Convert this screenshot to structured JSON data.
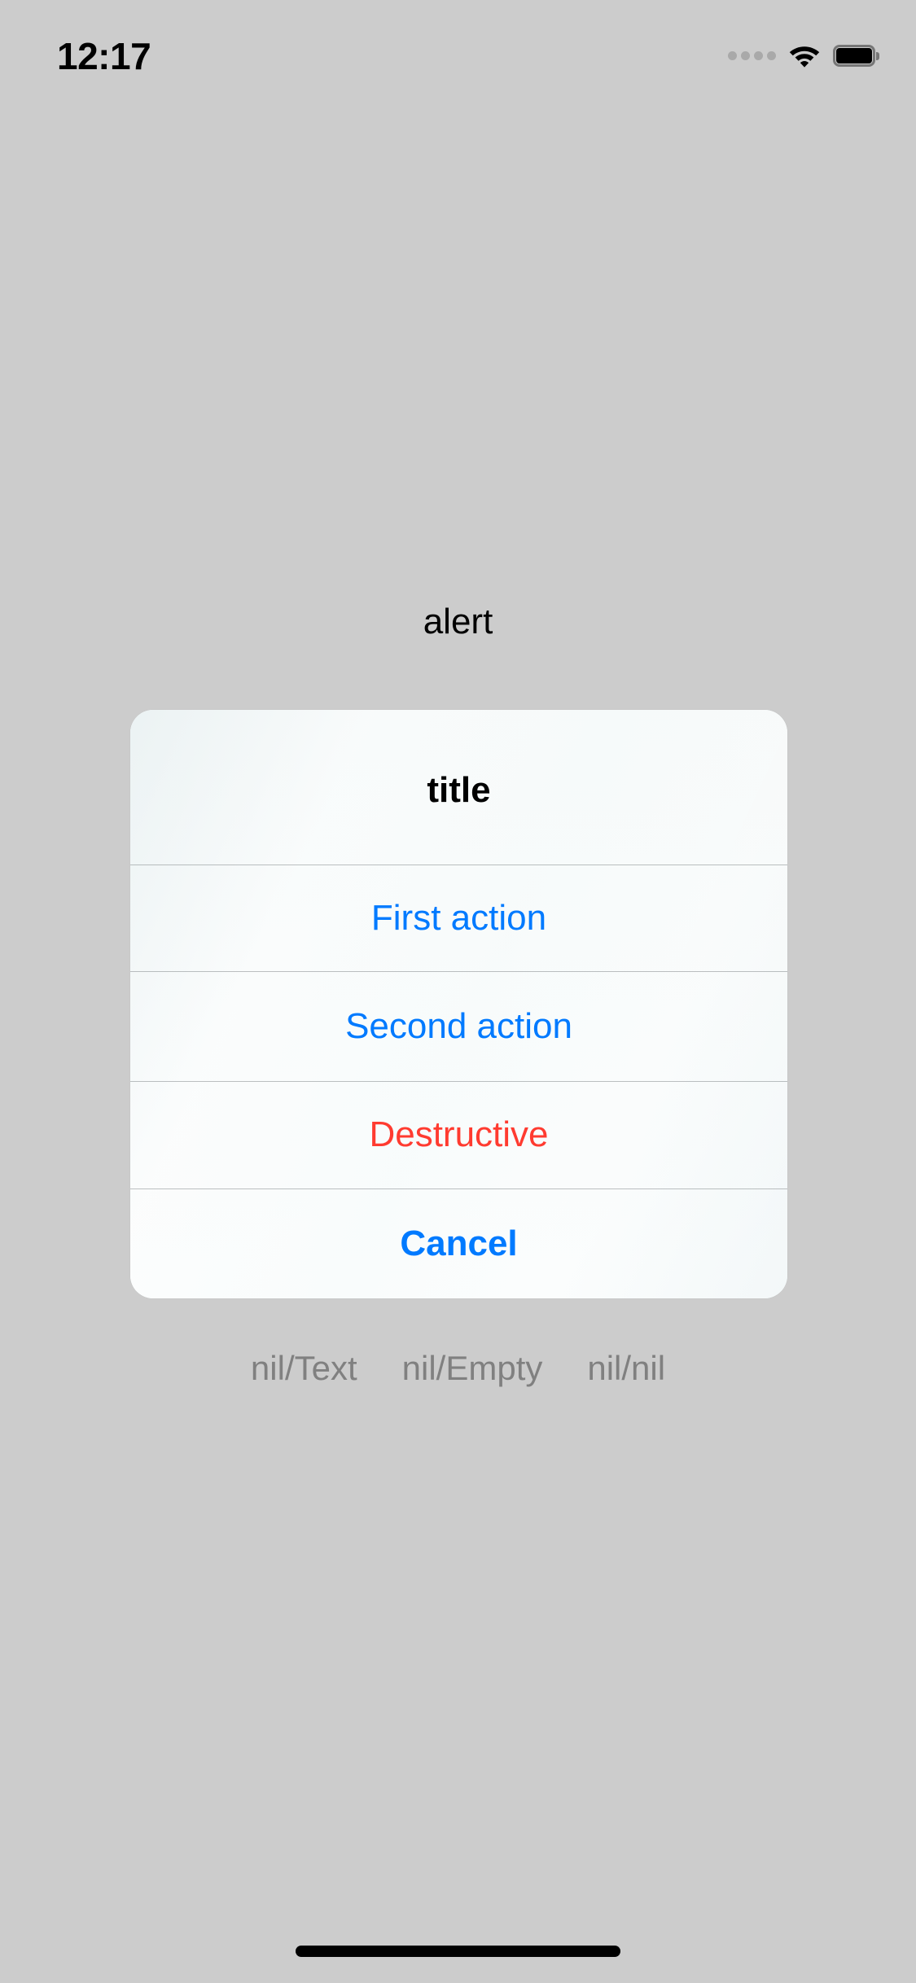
{
  "status_bar": {
    "time": "12:17",
    "icons": {
      "cellular": "cellular-dots-icon",
      "wifi": "wifi-icon",
      "battery": "battery-full-icon"
    }
  },
  "page": {
    "title": "alert"
  },
  "alert": {
    "title": "title",
    "actions": [
      {
        "label": "First action",
        "style": "default"
      },
      {
        "label": "Second action",
        "style": "default"
      },
      {
        "label": "Destructive",
        "style": "destructive"
      },
      {
        "label": "Cancel",
        "style": "cancel"
      }
    ]
  },
  "variants": [
    {
      "label": "nil/Text"
    },
    {
      "label": "nil/Empty"
    },
    {
      "label": "nil/nil"
    }
  ],
  "colors": {
    "background": "#cccccc",
    "tint_blue": "#007AFF",
    "destructive_red": "#FF3B30",
    "variant_gray": "#808080",
    "alert_surface": "#f9fbfb"
  }
}
